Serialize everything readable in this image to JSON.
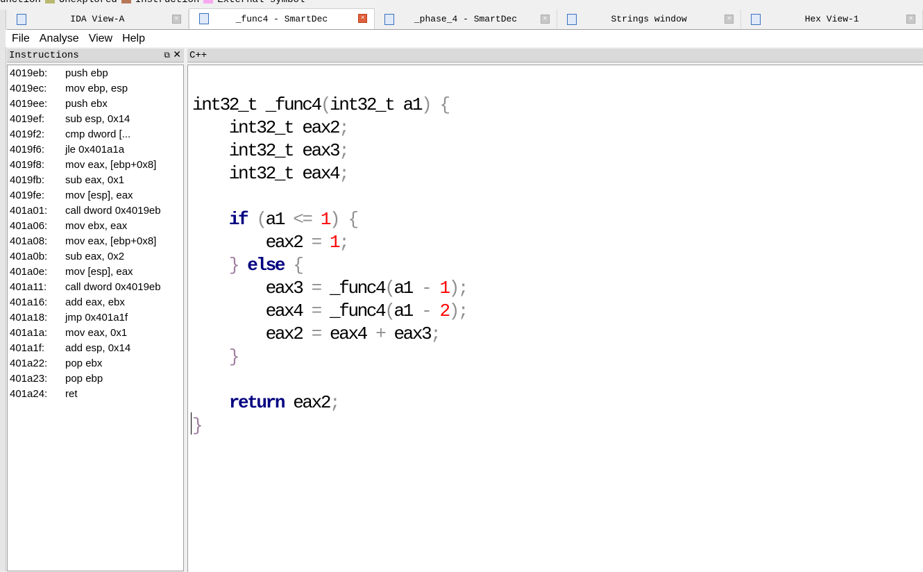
{
  "legend": [
    {
      "label": "unction",
      "color": "#b8b878"
    },
    {
      "label": "Unexplored",
      "color": "#b8b870"
    },
    {
      "label": "Instruction",
      "color": "#b87858"
    },
    {
      "label": "External symbol",
      "color": "#f8a8f0"
    }
  ],
  "tabs": [
    {
      "label": "IDA View-A",
      "active": false,
      "icon": "ida-view-icon"
    },
    {
      "label": "_func4 - SmartDec",
      "active": true,
      "icon": "smartdec-icon"
    },
    {
      "label": "_phase_4 - SmartDec",
      "active": false,
      "icon": "smartdec-icon"
    },
    {
      "label": "Strings window",
      "active": false,
      "icon": "strings-icon"
    },
    {
      "label": "Hex View-1",
      "active": false,
      "icon": "hex-view-icon"
    }
  ],
  "menu": [
    "File",
    "Analyse",
    "View",
    "Help"
  ],
  "instructions_panel": {
    "title": "Instructions",
    "rows": [
      [
        "4019eb:",
        "push ebp"
      ],
      [
        "4019ec:",
        "mov ebp, esp"
      ],
      [
        "4019ee:",
        "push ebx"
      ],
      [
        "4019ef:",
        "sub esp, 0x14"
      ],
      [
        "4019f2:",
        "cmp dword [..."
      ],
      [
        "4019f6:",
        "jle 0x401a1a"
      ],
      [
        "4019f8:",
        "mov eax, [ebp+0x8]"
      ],
      [
        "4019fb:",
        "sub eax, 0x1"
      ],
      [
        "4019fe:",
        "mov [esp], eax"
      ],
      [
        "401a01:",
        "call dword 0x4019eb"
      ],
      [
        "401a06:",
        "mov ebx, eax"
      ],
      [
        "401a08:",
        "mov eax, [ebp+0x8]"
      ],
      [
        "401a0b:",
        "sub eax, 0x2"
      ],
      [
        "401a0e:",
        "mov [esp], eax"
      ],
      [
        "401a11:",
        "call dword 0x4019eb"
      ],
      [
        "401a16:",
        "add eax, ebx"
      ],
      [
        "401a18:",
        "jmp 0x401a1f"
      ],
      [
        "401a1a:",
        "mov eax, 0x1"
      ],
      [
        "401a1f:",
        "add esp, 0x14"
      ],
      [
        "401a22:",
        "pop ebx"
      ],
      [
        "401a23:",
        "pop ebp"
      ],
      [
        "401a24:",
        "ret"
      ]
    ]
  },
  "code_panel": {
    "title": "C++",
    "lines": [
      [
        [
          "int32_t _func4",
          ""
        ],
        [
          "(",
          "pun"
        ],
        [
          "int32_t a1",
          ""
        ],
        [
          ")",
          "pun"
        ],
        [
          " ",
          ""
        ],
        [
          "{",
          "pun"
        ]
      ],
      [
        [
          "    int32_t eax2",
          ""
        ],
        [
          ";",
          "pun"
        ]
      ],
      [
        [
          "    int32_t eax3",
          ""
        ],
        [
          ";",
          "pun"
        ]
      ],
      [
        [
          "    int32_t eax4",
          ""
        ],
        [
          ";",
          "pun"
        ]
      ],
      [],
      [
        [
          "    ",
          ""
        ],
        [
          "if",
          "kw"
        ],
        [
          " ",
          ""
        ],
        [
          "(",
          "pun"
        ],
        [
          "a1 ",
          ""
        ],
        [
          "<=",
          "pun"
        ],
        [
          " ",
          ""
        ],
        [
          "1",
          "num"
        ],
        [
          ")",
          "pun"
        ],
        [
          " ",
          ""
        ],
        [
          "{",
          "pun"
        ]
      ],
      [
        [
          "        eax2 ",
          ""
        ],
        [
          "=",
          "pun"
        ],
        [
          " ",
          ""
        ],
        [
          "1",
          "num"
        ],
        [
          ";",
          "pun"
        ]
      ],
      [
        [
          "    ",
          ""
        ],
        [
          "}",
          "br"
        ],
        [
          " ",
          ""
        ],
        [
          "else",
          "kw"
        ],
        [
          " ",
          ""
        ],
        [
          "{",
          "pun"
        ]
      ],
      [
        [
          "        eax3 ",
          ""
        ],
        [
          "=",
          "pun"
        ],
        [
          " _func4",
          ""
        ],
        [
          "(",
          "pun"
        ],
        [
          "a1 ",
          ""
        ],
        [
          "-",
          "pun"
        ],
        [
          " ",
          ""
        ],
        [
          "1",
          "num"
        ],
        [
          ")",
          "pun"
        ],
        [
          ";",
          "pun"
        ]
      ],
      [
        [
          "        eax4 ",
          ""
        ],
        [
          "=",
          "pun"
        ],
        [
          " _func4",
          ""
        ],
        [
          "(",
          "pun"
        ],
        [
          "a1 ",
          ""
        ],
        [
          "-",
          "pun"
        ],
        [
          " ",
          ""
        ],
        [
          "2",
          "num"
        ],
        [
          ")",
          "pun"
        ],
        [
          ";",
          "pun"
        ]
      ],
      [
        [
          "        eax2 ",
          ""
        ],
        [
          "=",
          "pun"
        ],
        [
          " eax4 ",
          ""
        ],
        [
          "+",
          "pun"
        ],
        [
          " eax3",
          ""
        ],
        [
          ";",
          "pun"
        ]
      ],
      [
        [
          "    ",
          ""
        ],
        [
          "}",
          "br"
        ]
      ],
      [],
      [
        [
          "    ",
          ""
        ],
        [
          "return",
          "kw"
        ],
        [
          " eax2",
          ""
        ],
        [
          ";",
          "pun"
        ]
      ],
      [
        [
          "}",
          "br"
        ]
      ]
    ]
  }
}
